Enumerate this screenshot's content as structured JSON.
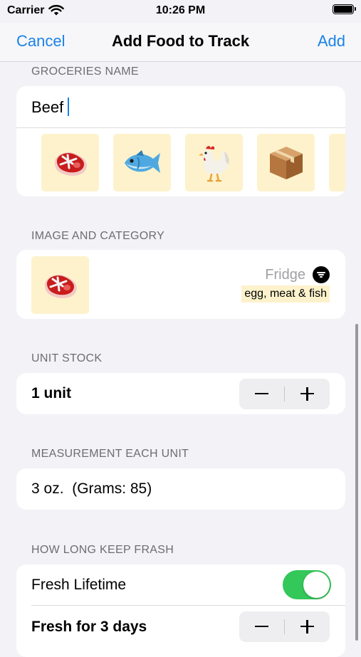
{
  "status_bar": {
    "carrier": "Carrier",
    "time": "10:26 PM"
  },
  "nav": {
    "cancel": "Cancel",
    "title": "Add Food to Track",
    "add": "Add"
  },
  "groceries": {
    "header": "GROCERIES NAME",
    "name_value": "Beef",
    "icons": [
      "steak-icon",
      "fish-icon",
      "rooster-icon",
      "package-icon"
    ]
  },
  "image_category": {
    "header": "IMAGE AND CATEGORY",
    "selected_icon": "steak-icon",
    "storage": "Fridge",
    "category": "egg, meat & fish"
  },
  "unit_stock": {
    "header": "UNIT STOCK",
    "value": "1 unit"
  },
  "measurement": {
    "header": "MEASUREMENT EACH UNIT",
    "value": "3 oz.  (Grams: 85)"
  },
  "freshness": {
    "header": "HOW LONG KEEP FRASH",
    "lifetime_label": "Fresh Lifetime",
    "lifetime_enabled": true,
    "days_label": "Fresh for 3 days"
  },
  "colors": {
    "accent": "#1a82e8",
    "toggle_on": "#34c759",
    "tile_bg": "#fdf2cc"
  }
}
